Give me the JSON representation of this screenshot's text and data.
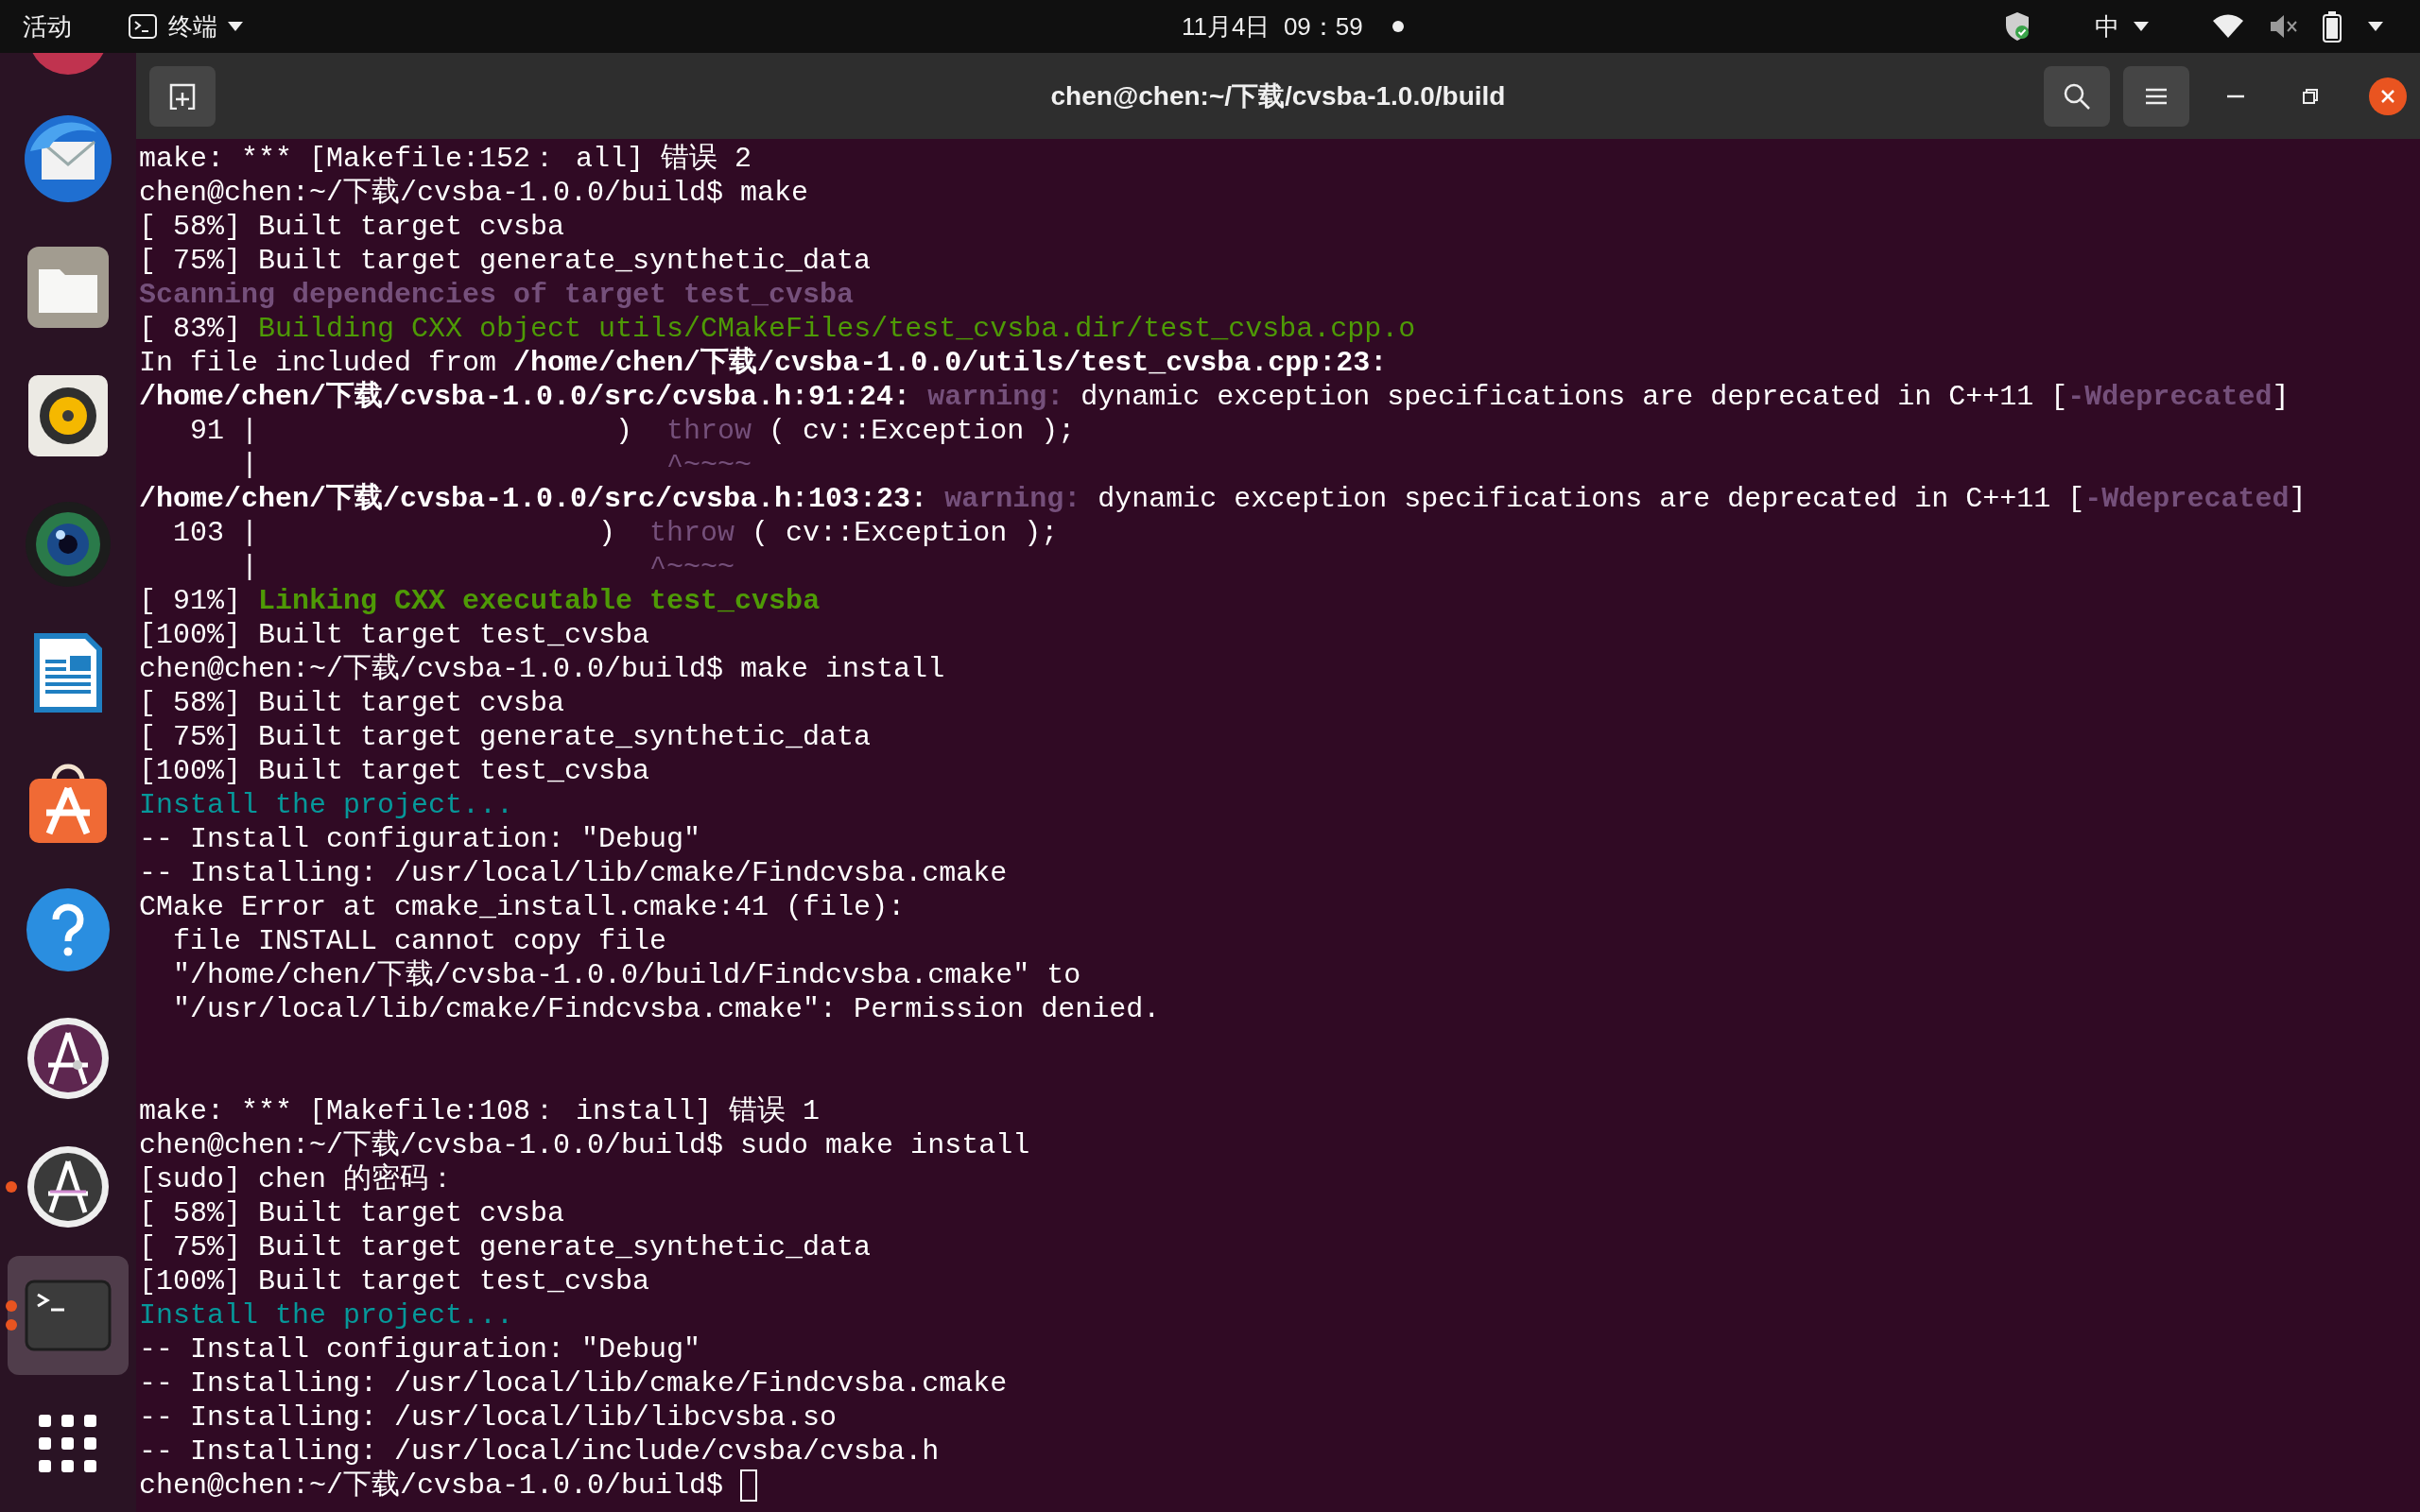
{
  "top_bar": {
    "activities": "活动",
    "app_menu": "终端",
    "clock": "11月4日  09：59",
    "input_method": "中"
  },
  "dock": [
    {
      "kind": "partial",
      "running": false,
      "selected": false
    },
    {
      "kind": "mail",
      "running": false,
      "selected": false
    },
    {
      "kind": "folder",
      "running": false,
      "selected": false
    },
    {
      "kind": "speaker",
      "running": false,
      "selected": false
    },
    {
      "kind": "camera",
      "running": false,
      "selected": false
    },
    {
      "kind": "document",
      "running": false,
      "selected": false
    },
    {
      "kind": "bag",
      "running": false,
      "selected": false
    },
    {
      "kind": "help",
      "running": false,
      "selected": false
    },
    {
      "kind": "letter_a",
      "running": false,
      "selected": false
    },
    {
      "kind": "letter_a_gray",
      "running": true,
      "selected": false
    },
    {
      "kind": "terminal",
      "running": true,
      "selected": true
    },
    {
      "kind": "grid",
      "running": false,
      "selected": false
    }
  ],
  "window": {
    "title": "chen@chen:~/下载/cvsba-1.0.0/build"
  },
  "terminal": {
    "lines": [
      {
        "kind": "text",
        "segments": [
          {
            "kind": "normal",
            "text": "make: *** [Makefile:152： all] 错误 2"
          }
        ]
      },
      {
        "kind": "text",
        "segments": [
          {
            "kind": "normal",
            "text": "chen@chen:~/下载/cvsba-1.0.0/build$ make"
          }
        ]
      },
      {
        "kind": "text",
        "segments": [
          {
            "kind": "normal",
            "text": "[ 58%] Built target cvsba"
          }
        ]
      },
      {
        "kind": "text",
        "segments": [
          {
            "kind": "normal",
            "text": "[ 75%] Built target generate_synthetic_data"
          }
        ]
      },
      {
        "kind": "text",
        "segments": [
          {
            "kind": "purple_bold",
            "text": "Scanning dependencies of target test_cvsba"
          }
        ]
      },
      {
        "kind": "text",
        "segments": [
          {
            "kind": "normal",
            "text": "[ 83%] "
          },
          {
            "kind": "green",
            "text": "Building CXX object utils/CMakeFiles/test_cvsba.dir/test_cvsba.cpp.o"
          }
        ]
      },
      {
        "kind": "text",
        "segments": [
          {
            "kind": "normal",
            "text": "In file included from "
          },
          {
            "kind": "bold",
            "text": "/home/chen/下载/cvsba-1.0.0/utils/test_cvsba.cpp:23:"
          }
        ]
      },
      {
        "kind": "text",
        "segments": [
          {
            "kind": "bold",
            "text": "/home/chen/下载/cvsba-1.0.0/src/cvsba.h:91:24: "
          },
          {
            "kind": "purple_bold",
            "text": "warning:"
          },
          {
            "kind": "normal",
            "text": " dynamic exception specifications are deprecated in C++11 ["
          },
          {
            "kind": "purple_bold",
            "text": "-Wdeprecated"
          },
          {
            "kind": "normal",
            "text": "]"
          }
        ]
      },
      {
        "kind": "text",
        "segments": [
          {
            "kind": "normal",
            "text": "   91 |                     )  "
          },
          {
            "kind": "purple",
            "text": "throw"
          },
          {
            "kind": "normal",
            "text": " ( cv::Exception );"
          }
        ]
      },
      {
        "kind": "text",
        "segments": [
          {
            "kind": "normal",
            "text": "      |                        "
          },
          {
            "kind": "purple",
            "text": "^~~~~"
          }
        ]
      },
      {
        "kind": "text",
        "segments": [
          {
            "kind": "bold",
            "text": "/home/chen/下载/cvsba-1.0.0/src/cvsba.h:103:23: "
          },
          {
            "kind": "purple_bold",
            "text": "warning:"
          },
          {
            "kind": "normal",
            "text": " dynamic exception specifications are deprecated in C++11 ["
          },
          {
            "kind": "purple_bold",
            "text": "-Wdeprecated"
          },
          {
            "kind": "normal",
            "text": "]"
          }
        ]
      },
      {
        "kind": "text",
        "segments": [
          {
            "kind": "normal",
            "text": "  103 |                    )  "
          },
          {
            "kind": "purple",
            "text": "throw"
          },
          {
            "kind": "normal",
            "text": " ( cv::Exception );"
          }
        ]
      },
      {
        "kind": "text",
        "segments": [
          {
            "kind": "normal",
            "text": "      |                       "
          },
          {
            "kind": "purple",
            "text": "^~~~~"
          }
        ]
      },
      {
        "kind": "text",
        "segments": [
          {
            "kind": "normal",
            "text": "[ 91%] "
          },
          {
            "kind": "green_bold",
            "text": "Linking CXX executable test_cvsba"
          }
        ]
      },
      {
        "kind": "text",
        "segments": [
          {
            "kind": "normal",
            "text": "[100%] Built target test_cvsba"
          }
        ]
      },
      {
        "kind": "text",
        "segments": [
          {
            "kind": "normal",
            "text": "chen@chen:~/下载/cvsba-1.0.0/build$ make install"
          }
        ]
      },
      {
        "kind": "text",
        "segments": [
          {
            "kind": "normal",
            "text": "[ 58%] Built target cvsba"
          }
        ]
      },
      {
        "kind": "text",
        "segments": [
          {
            "kind": "normal",
            "text": "[ 75%] Built target generate_synthetic_data"
          }
        ]
      },
      {
        "kind": "text",
        "segments": [
          {
            "kind": "normal",
            "text": "[100%] Built target test_cvsba"
          }
        ]
      },
      {
        "kind": "text",
        "segments": [
          {
            "kind": "cyan",
            "text": "Install the project..."
          }
        ]
      },
      {
        "kind": "text",
        "segments": [
          {
            "kind": "normal",
            "text": "-- Install configuration: \"Debug\""
          }
        ]
      },
      {
        "kind": "text",
        "segments": [
          {
            "kind": "normal",
            "text": "-- Installing: /usr/local/lib/cmake/Findcvsba.cmake"
          }
        ]
      },
      {
        "kind": "text",
        "segments": [
          {
            "kind": "normal",
            "text": "CMake Error at cmake_install.cmake:41 (file):"
          }
        ]
      },
      {
        "kind": "text",
        "segments": [
          {
            "kind": "normal",
            "text": "  file INSTALL cannot copy file"
          }
        ]
      },
      {
        "kind": "text",
        "segments": [
          {
            "kind": "normal",
            "text": "  \"/home/chen/下载/cvsba-1.0.0/build/Findcvsba.cmake\" to"
          }
        ]
      },
      {
        "kind": "text",
        "segments": [
          {
            "kind": "normal",
            "text": "  \"/usr/local/lib/cmake/Findcvsba.cmake\": Permission denied."
          }
        ]
      },
      {
        "kind": "blank"
      },
      {
        "kind": "blank"
      },
      {
        "kind": "text",
        "segments": [
          {
            "kind": "normal",
            "text": "make: *** [Makefile:108： install] 错误 1"
          }
        ]
      },
      {
        "kind": "text",
        "segments": [
          {
            "kind": "normal",
            "text": "chen@chen:~/下载/cvsba-1.0.0/build$ sudo make install"
          }
        ]
      },
      {
        "kind": "text",
        "segments": [
          {
            "kind": "normal",
            "text": "[sudo] chen 的密码："
          }
        ]
      },
      {
        "kind": "text",
        "segments": [
          {
            "kind": "normal",
            "text": "[ 58%] Built target cvsba"
          }
        ]
      },
      {
        "kind": "text",
        "segments": [
          {
            "kind": "normal",
            "text": "[ 75%] Built target generate_synthetic_data"
          }
        ]
      },
      {
        "kind": "text",
        "segments": [
          {
            "kind": "normal",
            "text": "[100%] Built target test_cvsba"
          }
        ]
      },
      {
        "kind": "text",
        "segments": [
          {
            "kind": "cyan",
            "text": "Install the project..."
          }
        ]
      },
      {
        "kind": "text",
        "segments": [
          {
            "kind": "normal",
            "text": "-- Install configuration: \"Debug\""
          }
        ]
      },
      {
        "kind": "text",
        "segments": [
          {
            "kind": "normal",
            "text": "-- Installing: /usr/local/lib/cmake/Findcvsba.cmake"
          }
        ]
      },
      {
        "kind": "text",
        "segments": [
          {
            "kind": "normal",
            "text": "-- Installing: /usr/local/lib/libcvsba.so"
          }
        ]
      },
      {
        "kind": "text",
        "segments": [
          {
            "kind": "normal",
            "text": "-- Installing: /usr/local/include/cvsba/cvsba.h"
          }
        ]
      },
      {
        "kind": "text",
        "cursor": true,
        "segments": [
          {
            "kind": "normal",
            "text": "chen@chen:~/下载/cvsba-1.0.0/build$ "
          }
        ]
      }
    ]
  }
}
